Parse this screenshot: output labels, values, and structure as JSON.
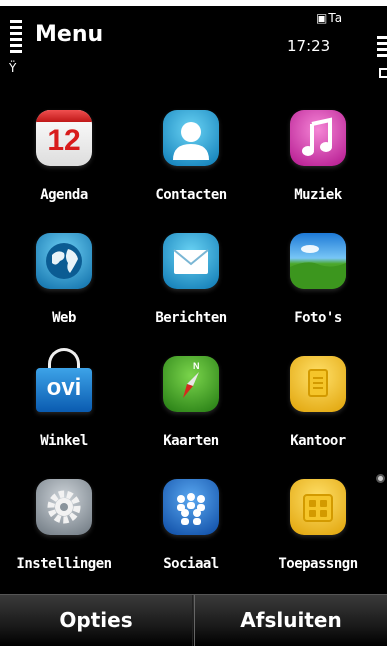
{
  "status_bar": {
    "title": "Menu",
    "time": "17:23"
  },
  "apps": [
    {
      "label": "Agenda",
      "icon": "calendar-icon",
      "date": "12"
    },
    {
      "label": "Contacten",
      "icon": "contacts-icon"
    },
    {
      "label": "Muziek",
      "icon": "music-note-icon"
    },
    {
      "label": "Web",
      "icon": "globe-icon"
    },
    {
      "label": "Berichten",
      "icon": "envelope-icon"
    },
    {
      "label": "Foto's",
      "icon": "landscape-photo-icon"
    },
    {
      "label": "Winkel",
      "icon": "ovi-store-bag-icon",
      "badge": "ovi"
    },
    {
      "label": "Kaarten",
      "icon": "compass-icon",
      "compass_letter": "N"
    },
    {
      "label": "Kantoor",
      "icon": "office-folder-icon"
    },
    {
      "label": "Instellingen",
      "icon": "gear-icon"
    },
    {
      "label": "Sociaal",
      "icon": "people-icon"
    },
    {
      "label": "Toepassngn",
      "icon": "apps-folder-icon"
    }
  ],
  "softkeys": {
    "left": "Opties",
    "right": "Afsluiten"
  }
}
